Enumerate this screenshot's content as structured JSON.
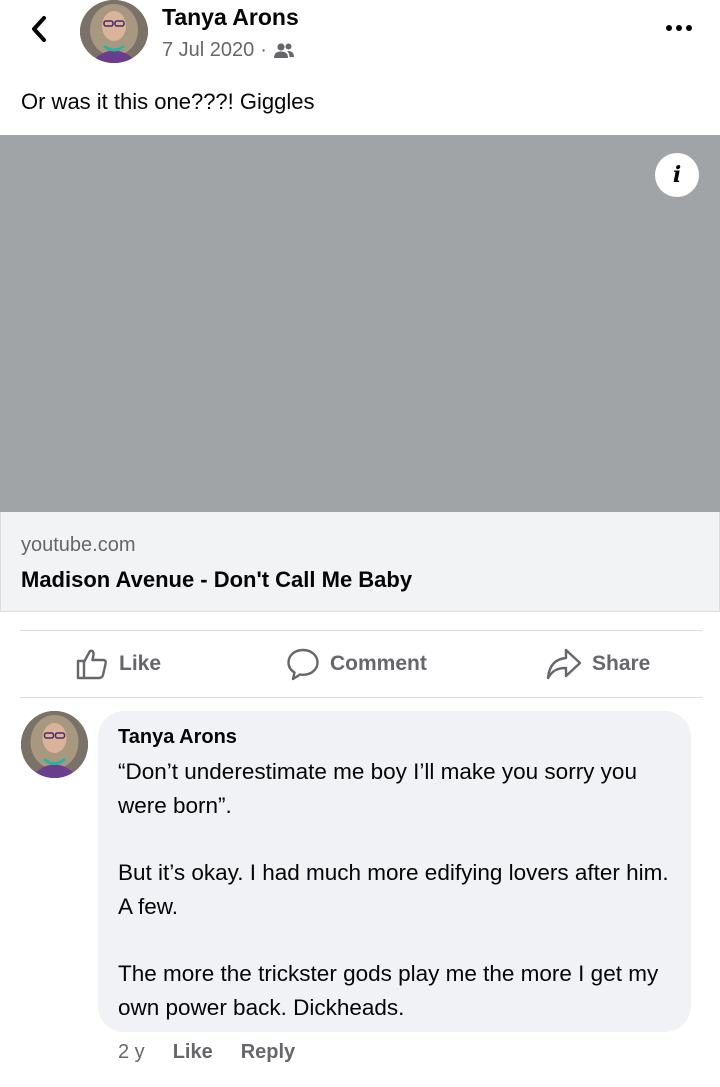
{
  "post": {
    "author": "Tanya Arons",
    "date": "7 Jul 2020",
    "separator": "·",
    "audience_icon": "friends-icon",
    "text": "Or was it this one???! Giggles"
  },
  "link_preview": {
    "domain": "youtube.com",
    "title": "Madison Avenue - Don't Call Me Baby"
  },
  "actions": {
    "like_label": "Like",
    "comment_label": "Comment",
    "share_label": "Share"
  },
  "comment": {
    "author": "Tanya Arons",
    "paragraphs": [
      "“Don’t underestimate me boy I’ll make you sorry you were born”.",
      "But it’s okay.  I had much more edifying lovers after him.  A few.",
      "The more the trickster gods play me the more I get my own power back.  Dickheads."
    ],
    "age": "2 y",
    "like_label": "Like",
    "reply_label": "Reply"
  },
  "colors": {
    "media_placeholder": "#a0a4a7",
    "secondary_text": "#65676b",
    "bubble_bg": "#f0f2f5"
  }
}
